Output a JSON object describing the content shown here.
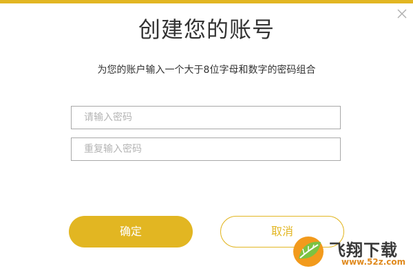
{
  "dialog": {
    "title": "创建您的账号",
    "subtitle": "为您的账户输入一个大于8位字母和数字的密码组合",
    "close_icon": "close-icon"
  },
  "form": {
    "password": {
      "value": "",
      "placeholder": "请输入密码"
    },
    "password_repeat": {
      "value": "",
      "placeholder": "重复输入密码"
    }
  },
  "buttons": {
    "confirm_label": "确定",
    "cancel_label": "取消"
  },
  "watermark": {
    "name": "飞翔下载",
    "url": "www.52z.com",
    "logo_icon": "leaf-logo-icon"
  },
  "colors": {
    "accent": "#e2b622",
    "text": "#333333",
    "border": "#a8a8a8",
    "placeholder": "#b4b4b4"
  }
}
